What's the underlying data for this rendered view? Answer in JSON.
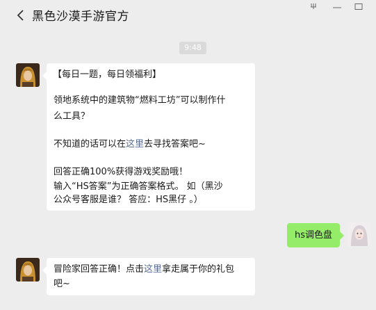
{
  "header": {
    "title": "黑色沙漠手游官方",
    "back_icon": "chevron-left-icon",
    "window_controls": [
      "pin-icon",
      "minimize-icon",
      "maximize-icon"
    ]
  },
  "timestamp": "9:48",
  "messages": [
    {
      "side": "left",
      "avatar": "game-character-avatar",
      "lines": {
        "l1": "【每日一题，每日领福利】",
        "l2": "领地系统中的建筑物“燃料工坊”可以制作什",
        "l3": "么工具？",
        "l4_pre": "不知道的话可以在",
        "l4_link": "这里",
        "l4_post": "去寻找答案吧~",
        "l5": "回答正确100%获得游戏奖励哦！",
        "l6": "输入“HS答案”为正确答案格式。 如（黑沙",
        "l7": "公众号客服是谁？ 答应：HS黑仔 。）"
      }
    },
    {
      "side": "right",
      "avatar": "user-avatar",
      "text": "hs调色盘"
    },
    {
      "side": "left",
      "avatar": "game-character-avatar",
      "lines": {
        "l1_pre": "冒险家回答正确！点击",
        "l1_link": "这里",
        "l1_post": "拿走属于你的礼包",
        "l2": "吧~"
      }
    }
  ],
  "colors": {
    "background": "#ededed",
    "bubble_self": "#95ec69",
    "bubble_other": "#ffffff",
    "link": "#576b95"
  }
}
